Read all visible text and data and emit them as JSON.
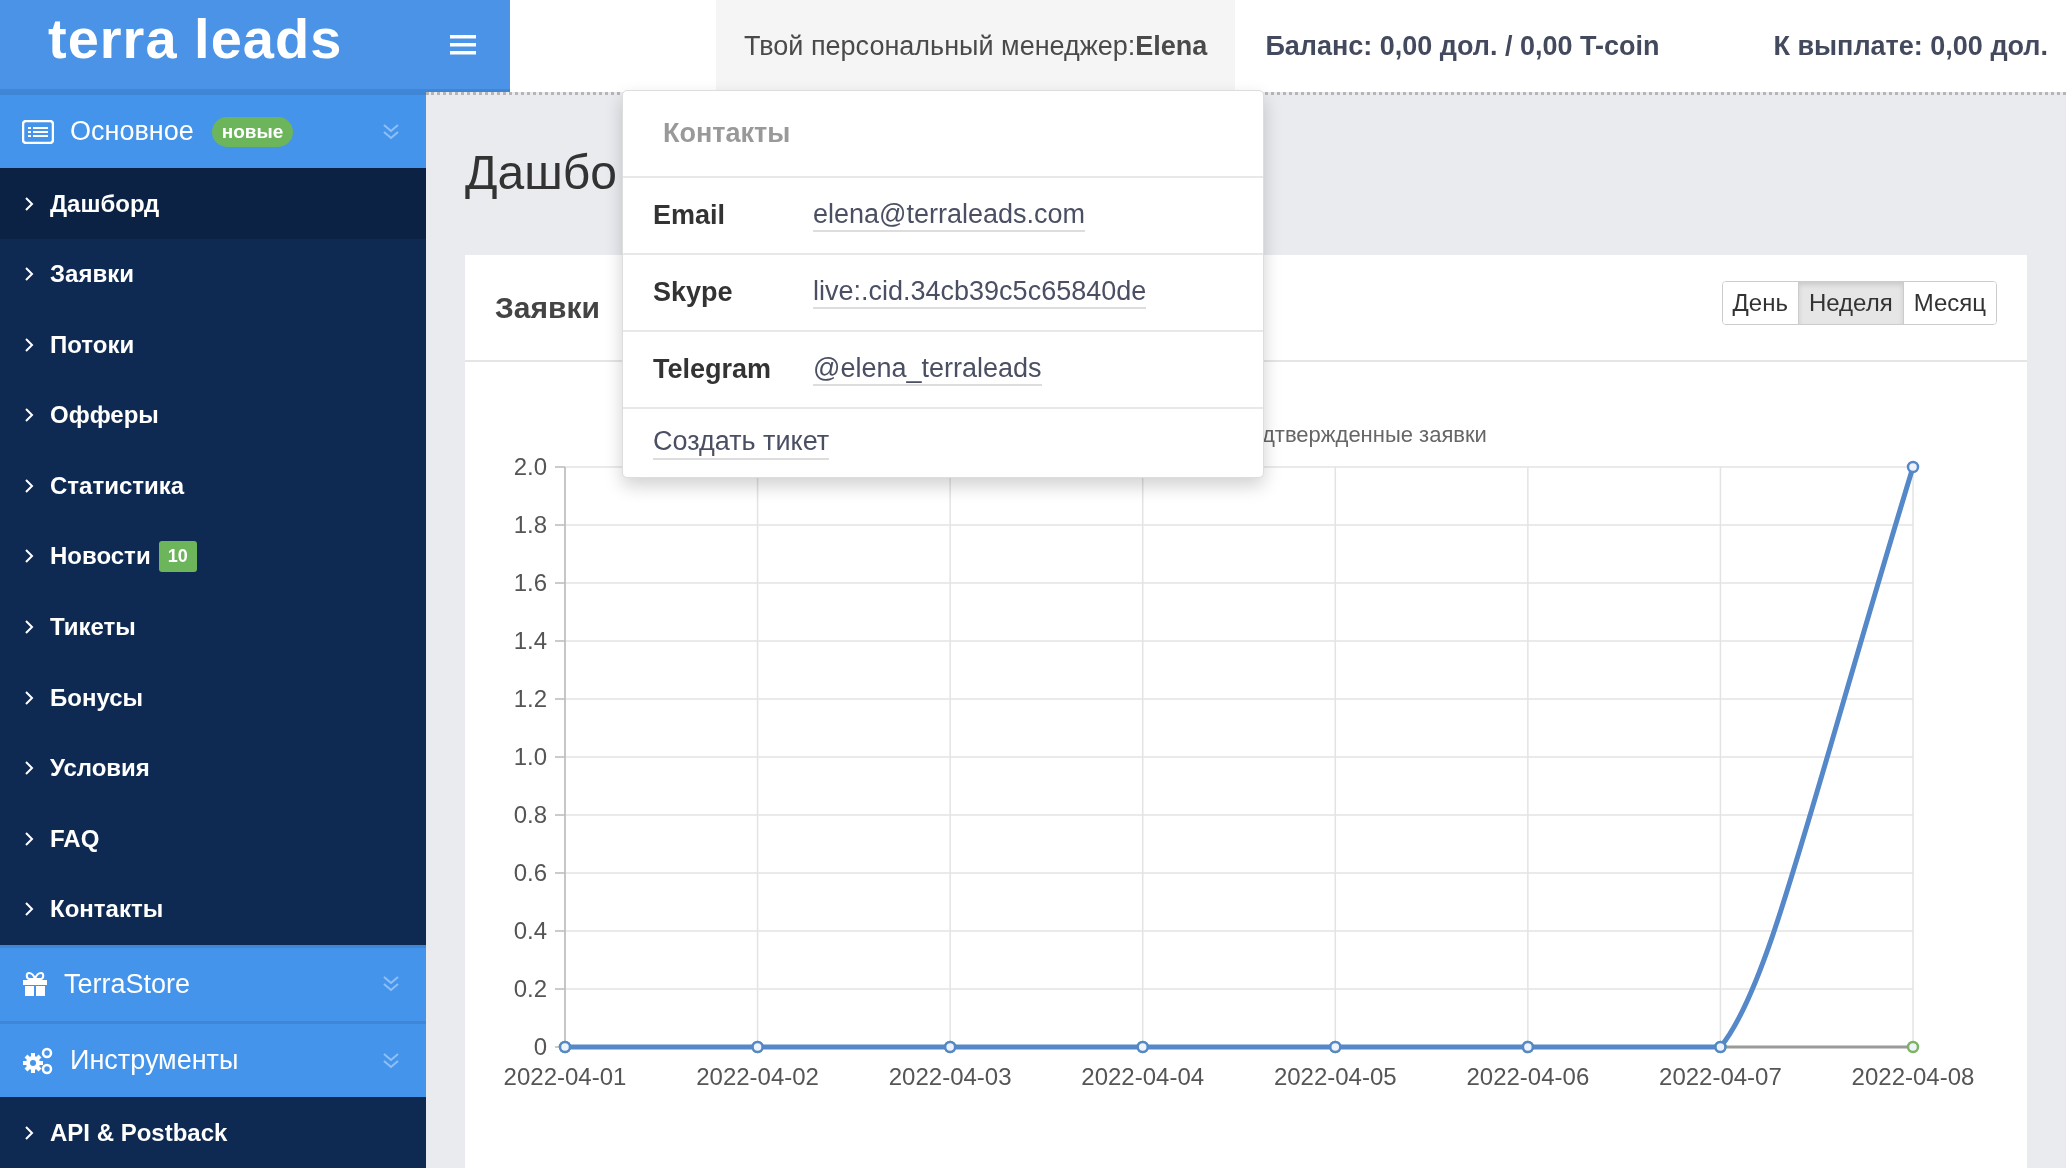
{
  "brand": {
    "logo": "terra leads"
  },
  "top_bar": {
    "manager_label": "Твой персональный менеджер:",
    "manager_name": "Elena",
    "balance": "Баланс: 0,00 дол. / 0,00 T-coin",
    "payout": "К выплате: 0,00 дол."
  },
  "sidebar": {
    "sections": [
      {
        "label": "Основное",
        "badge": "новые",
        "items": [
          {
            "label": "Дашборд",
            "selected": true
          },
          {
            "label": "Заявки",
            "selected": false
          },
          {
            "label": "Потоки",
            "selected": false
          },
          {
            "label": "Офферы",
            "selected": false
          },
          {
            "label": "Статистика",
            "selected": false
          },
          {
            "label": "Новости",
            "badge": "10",
            "selected": false
          },
          {
            "label": "Тикеты",
            "selected": false
          },
          {
            "label": "Бонусы",
            "selected": false
          },
          {
            "label": "Условия",
            "selected": false
          },
          {
            "label": "FAQ",
            "selected": false
          },
          {
            "label": "Контакты",
            "selected": false
          }
        ]
      },
      {
        "label": "TerraStore"
      },
      {
        "label": "Инструменты",
        "items": [
          {
            "label": "API & Postback",
            "selected": false
          }
        ]
      }
    ]
  },
  "page_title": "Дашбо",
  "card": {
    "title": "Заявки",
    "periods": [
      {
        "label": "День",
        "selected": false
      },
      {
        "label": "Неделя",
        "selected": true
      },
      {
        "label": "Месяц",
        "selected": false
      }
    ],
    "chart_data": {
      "type": "line",
      "grid": true,
      "categories": [
        "2022-04-01",
        "2022-04-02",
        "2022-04-03",
        "2022-04-04",
        "2022-04-05",
        "2022-04-06",
        "2022-04-07",
        "2022-04-08"
      ],
      "ylim": [
        0,
        2
      ],
      "yticks": [
        {
          "value": 0,
          "label": "0"
        },
        {
          "value": 0.2,
          "label": "0.2"
        },
        {
          "value": 0.4,
          "label": "0.4"
        },
        {
          "value": 0.6,
          "label": "0.6"
        },
        {
          "value": 0.8,
          "label": "0.8"
        },
        {
          "value": 1,
          "label": "1.0"
        },
        {
          "value": 1.2,
          "label": "1.2"
        },
        {
          "value": 1.4,
          "label": "1.4"
        },
        {
          "value": 1.6,
          "label": "1.6"
        },
        {
          "value": 1.8,
          "label": "1.8"
        },
        {
          "value": 2,
          "label": "2.0"
        }
      ],
      "series": [
        {
          "color": "#5588c8",
          "marker": true,
          "values": [
            0,
            0,
            0,
            0,
            0,
            0,
            0,
            2
          ]
        },
        {
          "name": "дтвержденные заявки",
          "color": "#79b464",
          "marker": true,
          "values": [
            0,
            0,
            0,
            0,
            0,
            0,
            0,
            0
          ]
        }
      ]
    }
  },
  "contacts_popup": {
    "title": "Контакты",
    "rows": [
      {
        "label": "Email",
        "value": "elena@terraleads.com"
      },
      {
        "label": "Skype",
        "value": "live:.cid.34cb39c5c65840de"
      },
      {
        "label": "Telegram",
        "value": "@elena_terraleads"
      }
    ],
    "action": "Создать тикет"
  }
}
